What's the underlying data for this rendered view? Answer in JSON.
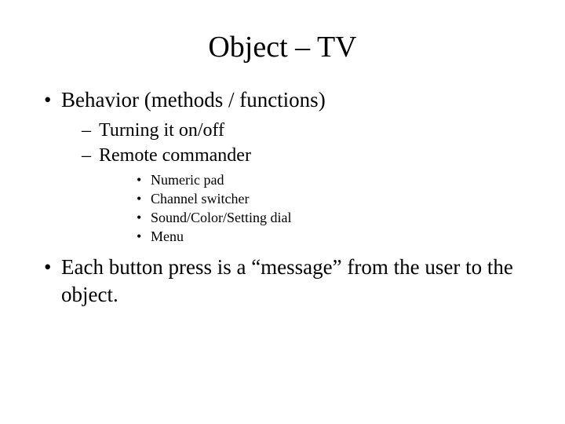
{
  "title": "Object – TV",
  "bullets": {
    "behavior": {
      "label": "Behavior (methods / functions)",
      "subs": {
        "onoff": "Turning it on/off",
        "remote": {
          "label": "Remote commander",
          "items": [
            "Numeric pad",
            "Channel switcher",
            "Sound/Color/Setting dial",
            "Menu"
          ]
        }
      }
    },
    "message": "Each button press is a “message” from the user to the object."
  }
}
